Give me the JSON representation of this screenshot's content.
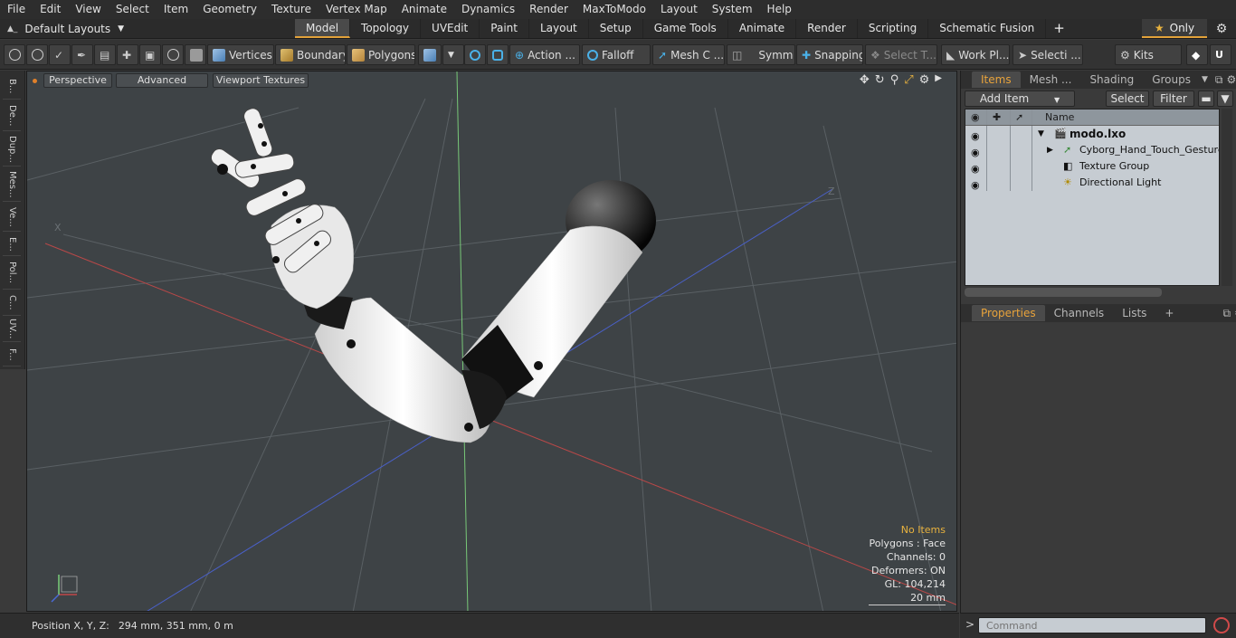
{
  "menu": [
    "File",
    "Edit",
    "View",
    "Select",
    "Item",
    "Geometry",
    "Texture",
    "Vertex Map",
    "Animate",
    "Dynamics",
    "Render",
    "MaxToModo",
    "Layout",
    "System",
    "Help"
  ],
  "layouts": {
    "label": "Default Layouts"
  },
  "tabs": [
    "Model",
    "Topology",
    "UVEdit",
    "Paint",
    "Layout",
    "Setup",
    "Game Tools",
    "Animate",
    "Render",
    "Scripting",
    "Schematic Fusion"
  ],
  "active_tab": "Model",
  "only_label": "Only",
  "toolbar": {
    "vertices": "Vertices",
    "boundary": "Boundary",
    "polygons": "Polygons",
    "action": "Action ...",
    "falloff": "Falloff",
    "mesh_c": "Mesh C ...",
    "symm": "Symm ...",
    "snapping": "Snapping",
    "select_t": "Select T...",
    "work_pl": "Work Pl...",
    "selecti": "Selecti ...",
    "kits": "Kits"
  },
  "left_tabs": [
    "B...",
    "De...",
    "Dup...",
    "Mes...",
    "Ve...",
    "E...",
    "Pol...",
    "C...",
    "UV...",
    "F..."
  ],
  "viewport": {
    "perspective": "Perspective",
    "advanced": "Advanced",
    "textures": "Viewport Textures",
    "info": {
      "no_items": "No Items",
      "polygons": "Polygons : Face",
      "channels": "Channels: 0",
      "deformers": "Deformers: ON",
      "gl": "GL: 104,214",
      "scale": "20 mm"
    }
  },
  "status": {
    "label": "Position X, Y, Z:",
    "value": "294 mm, 351 mm, 0 m"
  },
  "items_panel": {
    "tabs": [
      "Items",
      "Mesh ...",
      "Shading",
      "Groups"
    ],
    "add_item": "Add Item",
    "select": "Select",
    "filter": "Filter",
    "name_header": "Name",
    "rows": [
      "modo.lxo",
      "Cyborg_Hand_Touch_Gesture",
      "Texture Group",
      "Directional Light"
    ]
  },
  "props_panel": {
    "tabs": [
      "Properties",
      "Channels",
      "Lists"
    ]
  },
  "command": {
    "placeholder": "Command"
  },
  "colors": {
    "accent": "#e2a23a",
    "axis_x": "#c04848",
    "axis_y": "#7ad07a",
    "axis_z": "#4a6ad8"
  }
}
